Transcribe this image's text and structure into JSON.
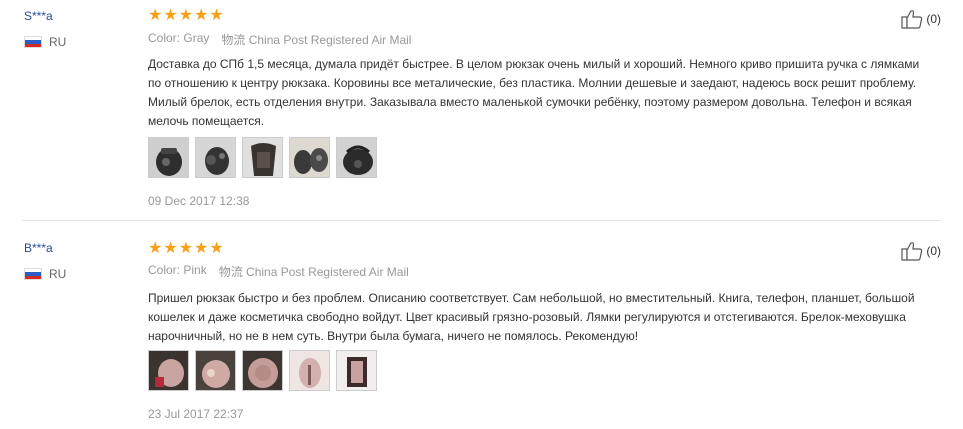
{
  "reviews": [
    {
      "user": "S***a",
      "country": "RU",
      "stars": 5,
      "color_label": "Color:",
      "color_value": "Gray",
      "shipping": "物流 China Post Registered Air Mail",
      "text": "Доставка до СПб 1,5 месяца, думала придёт быстрее. В целом рюкзак очень милый и хороший. Немного криво пришита ручка с лямками по отношению к центру рюкзака. Коровины все металические, без пластика. Молнии дешевые и заедают, надеюсь воск решит проблему. Милый брелок, есть отделения внутри. Заказывала вместо маленькой сумочки ребёнку, поэтому размером довольна. Телефон и всякая мелочь помещается.",
      "photos_count": 5,
      "date": "09 Dec 2017 12:38",
      "helpful_count": "(0)"
    },
    {
      "user": "B***a",
      "country": "RU",
      "stars": 5,
      "color_label": "Color:",
      "color_value": "Pink",
      "shipping": "物流 China Post Registered Air Mail",
      "text": "Пришел рюкзак быстро и без проблем. Описанию соответствует. Сам небольшой, но вместительный. Книга, телефон, планшет, большой кошелек и даже косметичка свободно войдут. Цвет красивый грязно-розовый. Лямки регулируются и отстегиваются. Брелок-меховушка нарочничный, но не в нем суть. Внутри была бумага, ничего не помялось. Рекомендую!",
      "photos_count": 5,
      "date": "23 Jul 2017 22:37",
      "helpful_count": "(0)"
    }
  ],
  "colors": {
    "star": "#f7a11a",
    "username": "#2a4e9a",
    "muted": "#999999"
  }
}
